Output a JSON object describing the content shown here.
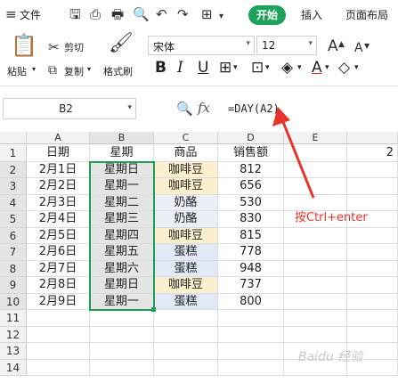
{
  "menubar": {
    "file_label": "文件",
    "tabs": [
      "开始",
      "插入",
      "页面布局"
    ],
    "accent": "#1ea35a"
  },
  "ribbon": {
    "paste": "粘贴",
    "cut": "剪切",
    "copy": "复制",
    "format_painter": "格式刷",
    "font_name": "宋体",
    "font_size": "12",
    "grow_font": "A",
    "shrink_font": "A",
    "bold": "B",
    "italic": "I",
    "underline": "U",
    "font_color_letter": "A"
  },
  "formula_bar": {
    "name_box": "B2",
    "fx": "fx",
    "formula": "=DAY(A2)"
  },
  "columns": [
    "A",
    "B",
    "C",
    "D",
    "E"
  ],
  "partial_column_value": "2",
  "rows": [
    {
      "n": "1",
      "a": "日期",
      "b": "星期",
      "c": "商品",
      "d": "销售额"
    },
    {
      "n": "2",
      "a": "2月1日",
      "b": "星期日",
      "c": "咖啡豆",
      "d": "812"
    },
    {
      "n": "3",
      "a": "2月2日",
      "b": "星期一",
      "c": "咖啡豆",
      "d": "656"
    },
    {
      "n": "4",
      "a": "2月3日",
      "b": "星期二",
      "c": "奶酪",
      "d": "530"
    },
    {
      "n": "5",
      "a": "2月4日",
      "b": "星期三",
      "c": "奶酪",
      "d": "830"
    },
    {
      "n": "6",
      "a": "2月5日",
      "b": "星期四",
      "c": "咖啡豆",
      "d": "815"
    },
    {
      "n": "7",
      "a": "2月6日",
      "b": "星期五",
      "c": "蛋糕",
      "d": "778"
    },
    {
      "n": "8",
      "a": "2月7日",
      "b": "星期六",
      "c": "蛋糕",
      "d": "948"
    },
    {
      "n": "9",
      "a": "2月8日",
      "b": "星期日",
      "c": "咖啡豆",
      "d": "737"
    },
    {
      "n": "10",
      "a": "2月9日",
      "b": "星期一",
      "c": "蛋糕",
      "d": "800"
    },
    {
      "n": "11",
      "a": "",
      "b": "",
      "c": "",
      "d": ""
    },
    {
      "n": "12",
      "a": "",
      "b": "",
      "c": "",
      "d": ""
    },
    {
      "n": "13",
      "a": "",
      "b": "",
      "c": "",
      "d": ""
    },
    {
      "n": "14",
      "a": "",
      "b": "",
      "c": "",
      "d": ""
    }
  ],
  "annotation": {
    "text": "按Ctrl+enter",
    "color": "#e8322a"
  },
  "watermark": "Baidu 经验"
}
